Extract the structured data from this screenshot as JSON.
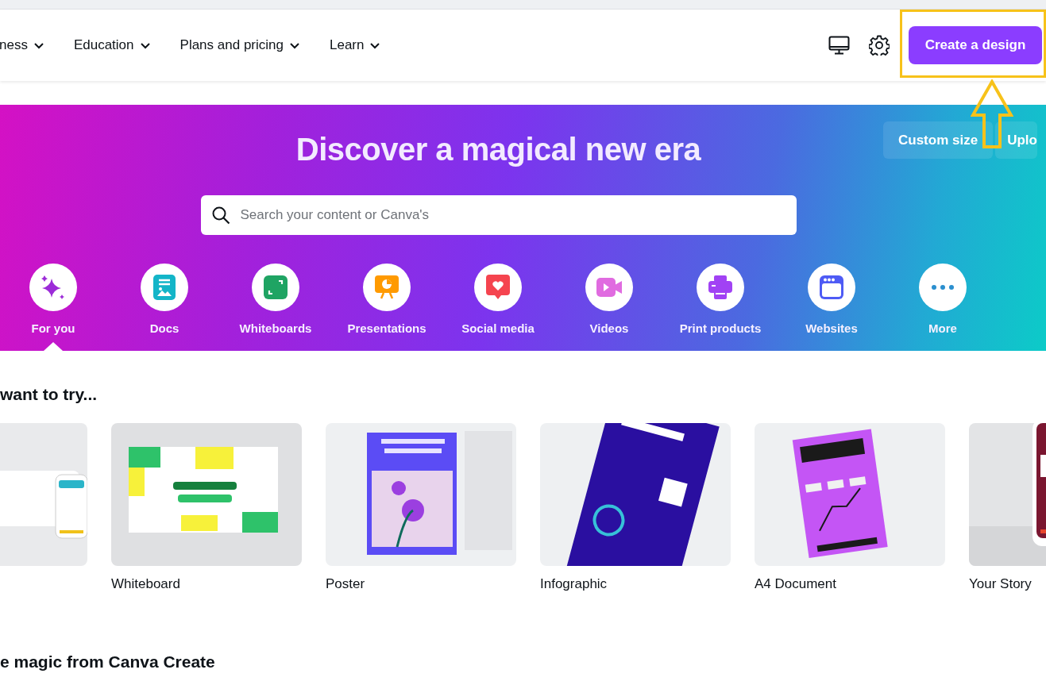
{
  "nav": {
    "items": [
      {
        "label": "ness"
      },
      {
        "label": "Education"
      },
      {
        "label": "Plans and pricing"
      },
      {
        "label": "Learn"
      }
    ],
    "create_button": "Create a design"
  },
  "hero": {
    "title": "Discover a magical new era",
    "search": {
      "placeholder": "Search your content or Canva's"
    },
    "actions": [
      "Custom size",
      "Uplo"
    ],
    "categories": [
      {
        "label": "For you",
        "selected": true
      },
      {
        "label": "Docs",
        "selected": false
      },
      {
        "label": "Whiteboards",
        "selected": false
      },
      {
        "label": "Presentations",
        "selected": false
      },
      {
        "label": "Social media",
        "selected": false
      },
      {
        "label": "Videos",
        "selected": false
      },
      {
        "label": "Print products",
        "selected": false
      },
      {
        "label": "Websites",
        "selected": false
      },
      {
        "label": "More",
        "selected": false
      }
    ]
  },
  "try_section": {
    "heading": "want to try...",
    "cards": [
      {
        "kind": "picture"
      },
      {
        "kind": "picture",
        "label": "Whiteboard"
      },
      {
        "kind": "picture",
        "label": "Poster"
      },
      {
        "kind": "picture",
        "label": "Infographic"
      },
      {
        "kind": "picture",
        "label": "A4 Document"
      },
      {
        "kind": "picture",
        "label": "Your Story"
      }
    ]
  },
  "next_section": {
    "heading": "e magic from Canva Create"
  }
}
